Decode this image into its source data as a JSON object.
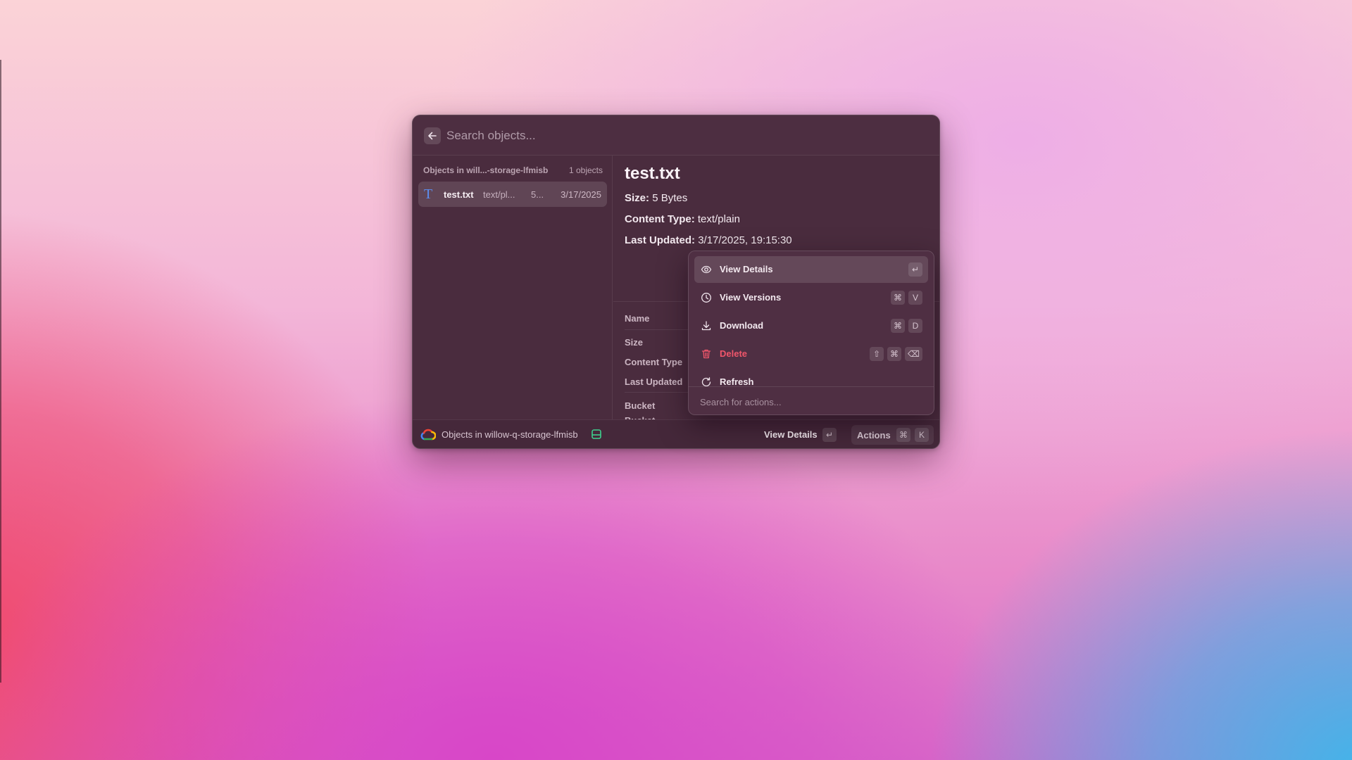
{
  "search": {
    "placeholder": "Search objects..."
  },
  "list": {
    "header": "Objects in will...-storage-lfmisb",
    "count": "1 objects",
    "items": [
      {
        "name": "test.txt",
        "content_type": "text/pl...",
        "size": "5...",
        "date": "3/17/2025"
      }
    ]
  },
  "detail": {
    "title": "test.txt",
    "size_label": "Size:",
    "size_value": "5 Bytes",
    "content_type_label": "Content Type:",
    "content_type_value": "text/plain",
    "last_updated_label": "Last Updated:",
    "last_updated_value": "3/17/2025, 19:15:30",
    "metadata_labels": [
      "Name",
      "Size",
      "Content Type",
      "Last Updated",
      "Bucket",
      "Bucket"
    ]
  },
  "footer": {
    "label": "Objects in willow-q-storage-lfmisb",
    "primary_action": "View Details",
    "primary_key": "↵",
    "actions_label": "Actions",
    "actions_keys": [
      "⌘",
      "K"
    ]
  },
  "menu": {
    "items": [
      {
        "label": "View Details",
        "icon": "eye-icon",
        "keys": [
          "↵"
        ],
        "selected": true
      },
      {
        "label": "View Versions",
        "icon": "clock-icon",
        "keys": [
          "⌘",
          "V"
        ]
      },
      {
        "label": "Download",
        "icon": "download-icon",
        "keys": [
          "⌘",
          "D"
        ]
      },
      {
        "label": "Delete",
        "icon": "trash-icon",
        "keys": [
          "⇧",
          "⌘",
          "⌫"
        ],
        "danger": true
      },
      {
        "label": "Refresh",
        "icon": "refresh-icon",
        "keys": []
      }
    ],
    "search_placeholder": "Search for actions..."
  },
  "colors": {
    "danger": "#f0566b",
    "accent": "#5b8ef0",
    "bucket_icon": "#3ecf8e"
  }
}
